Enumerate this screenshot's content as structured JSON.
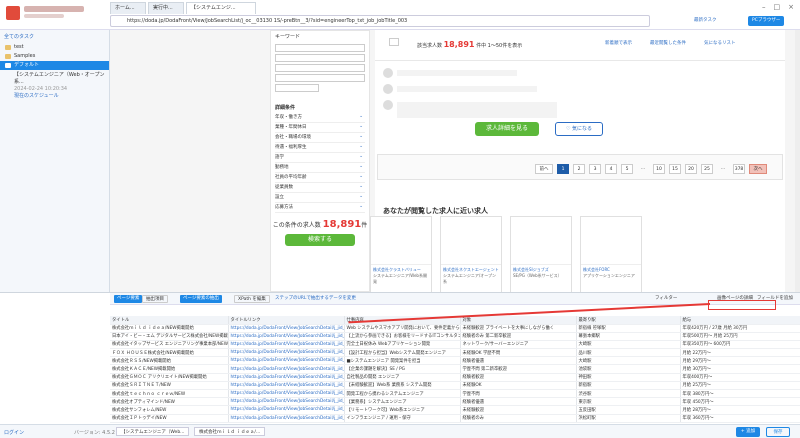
{
  "app": {
    "status_left": "ログイン",
    "version": "バージョン: 4.5.2",
    "buttons": {
      "add": "+ 追加",
      "save": "保存"
    }
  },
  "tabs": [
    {
      "label": "ホーム..."
    },
    {
      "label": "実行中..."
    },
    {
      "label": "【システムエンジ..."
    }
  ],
  "url": "https://doda.jp/DodaFront/View/JobSearchList/j_oc__03130 1S/-preBtn__3/?sid=engineerTop_txt_job_jobTitle_003",
  "top_buttons": {
    "task": "最新タスク",
    "pro": "PCブラウザー"
  },
  "left": {
    "header": "全てのタスク",
    "items": [
      "test",
      "Samples",
      "デフォルト"
    ],
    "task_name": "【システムエンジニア（Web・オープン系...",
    "task_meta": "2024-02-24 10:20:34",
    "task_status": "現在のスケジュール"
  },
  "page": {
    "keyword_label": "キーワード",
    "hits_prefix": "該当求人数",
    "hits": "18,891",
    "hits_suffix": "件中 1～50件を表示",
    "sort": [
      "新着順で表示",
      "最近閲覧した条件",
      "気になるリスト"
    ],
    "detail_title": "詳細条件",
    "filters": [
      "年収・働き方",
      "業種・年間休日",
      "会社・職場の環境",
      "待遇・福利厚生",
      "語学",
      "勤務地",
      "社員の平均年齢",
      "従業員数",
      "設立",
      "応募方法"
    ],
    "result_label": "この条件の求人数",
    "result_count": "18,891",
    "result_unit": "件",
    "search_btn": "検索する",
    "view_btn": "求人詳細を見る",
    "fav_btn": "気になる",
    "pages": [
      "前へ",
      "1",
      "2",
      "3",
      "4",
      "5",
      "...",
      "10",
      "15",
      "20",
      "25",
      "...",
      "378",
      "次へ"
    ],
    "recent_title": "あなたが閲覧した求人に近い求人",
    "jobs": [
      {
        "co": "株式会社クラストバリュー",
        "txt": "システムエンジニア/Web系開発"
      },
      {
        "co": "株式会社ネクストエージェント",
        "txt": "システムエンジニア/オープン系"
      },
      {
        "co": "株式会社SIジョブズ",
        "txt": "SE/PG（Web系サービス）"
      },
      {
        "co": "株式会社FORC",
        "txt": "アプリケーションエンジニア"
      }
    ]
  },
  "grid": {
    "tools": [
      "ページ要素",
      "抽出項目",
      "ページ要素の抽出",
      "XPath を編集",
      "ステップのURLで抽出するデータを変更"
    ],
    "right_tools": [
      "フィルター",
      "画像ページの詳細",
      "フィールドを追加"
    ],
    "headers": [
      "タイトル",
      "タイトルリンク",
      "仕事内容",
      "対象",
      "最寄り駅",
      "給与"
    ],
    "rows": [
      [
        "株式会社ｍｉｌｄ ｉｄｅａ/NEW掲載開始",
        "https://doda.jp/DodaFront/View/JobSearchDetail/j_jid__30...",
        "Web システムやスマホアプリ開発において、要件定義から保守まで",
        "未経験歓迎 プライベートを大事にしながら働く",
        "新宿線 笹塚駅",
        "年収420万円 / 27歳 月給 30万円"
      ],
      [
        "日本アイ・ビー・エム デジタルサービス株式会社/NEW掲載開始",
        "https://doda.jp/DodaFront/View/JobSearchDetail/j_jid__30...",
        "【上流から参画できる】お客様をリードするITコンサルタント",
        "経験者のみ 第二新卒歓迎",
        "幕張本郷駅",
        "年収500万円～ 月給 25万円"
      ],
      [
        "株式会社イタップサービス エンジニアリング事業本部/NEW掲載開始",
        "https://doda.jp/DodaFront/View/JobSearchDetail/j_jid__30...",
        "完全土日祝休み Webアプリケーション開発",
        "ネットワーク/サーバーエンジニア",
        "大崎駅",
        "年収350万円～ 600万円"
      ],
      [
        "ＦＯＸ ＨＯＵＳＥ株式会社/NEW掲載開始",
        "https://doda.jp/DodaFront/View/JobSearchDetail/j_jid__30...",
        "【設計工程から担当】Webシステム開発エンジニア",
        "未経験OK 学歴不問",
        "品川駅",
        "月給 22万円～"
      ],
      [
        "株式会社ＲＳＳ/NEW掲載開始",
        "https://doda.jp/DodaFront/View/JobSearchDetail/j_jid__30...",
        "■システムエンジニア 開発案件を担当",
        "経験者優遇",
        "大崎駅",
        "月給 29万円～"
      ],
      [
        "株式会社ＫＡＣＥ/NEW掲載開始",
        "https://doda.jp/DodaFront/View/JobSearchDetail/j_jid__30...",
        "【企業の課題を解決】SE / PG",
        "学歴不問 第二新卒歓迎",
        "池袋駅",
        "月給 30万円～"
      ],
      [
        "株式会社ＧＭＯＣ アリクリエイト/NEW掲載開始",
        "https://doda.jp/DodaFront/View/JobSearchDetail/j_jid__30...",
        "自社製品の開発 エンジニア",
        "経験者歓迎",
        "神田駅",
        "年収400万円～"
      ],
      [
        "株式会社ＳＲＩＴＮＥＴ/NEW",
        "https://doda.jp/DodaFront/View/JobSearchDetail/j_jid__30...",
        "【未経験歓迎】Web系 業務系 システム開発",
        "未経験OK",
        "新宿駅",
        "月給 25万円～"
      ],
      [
        "株式会社ｔｅｃｈｎｏ ｃｒｅｗ/NEW",
        "https://doda.jp/DodaFront/View/JobSearchDetail/j_jid__30...",
        "開発工程から携わるシステムエンジニア",
        "学歴不問",
        "渋谷駅",
        "年収 380万円～"
      ],
      [
        "株式会社オプティマインド/NEW",
        "https://doda.jp/DodaFront/View/JobSearchDetail/j_jid__30...",
        "【業務系】システムエンジニア",
        "経験者優遇",
        "東京駅",
        "年収 450万円～"
      ],
      [
        "株式会社サンフォレム/NEW",
        "https://doda.jp/DodaFront/View/JobSearchDetail/j_jid__30...",
        "【リモートワーク可】Web系エンジニア",
        "未経験歓迎",
        "五反田駅",
        "月給 28万円～"
      ],
      [
        "株式会社ＩＰトゥデイ/NEW",
        "https://doda.jp/DodaFront/View/JobSearchDetail/j_jid__30...",
        "インフラエンジニア / 運用・保守",
        "経験者のみ",
        "浜松町駅",
        "年収 360万円～"
      ]
    ],
    "bottom_tab": "【システムエンジニア（Web...",
    "bottom_tab2": "株式会社ｍｉｌｄ ｉｄｅａ/..."
  }
}
